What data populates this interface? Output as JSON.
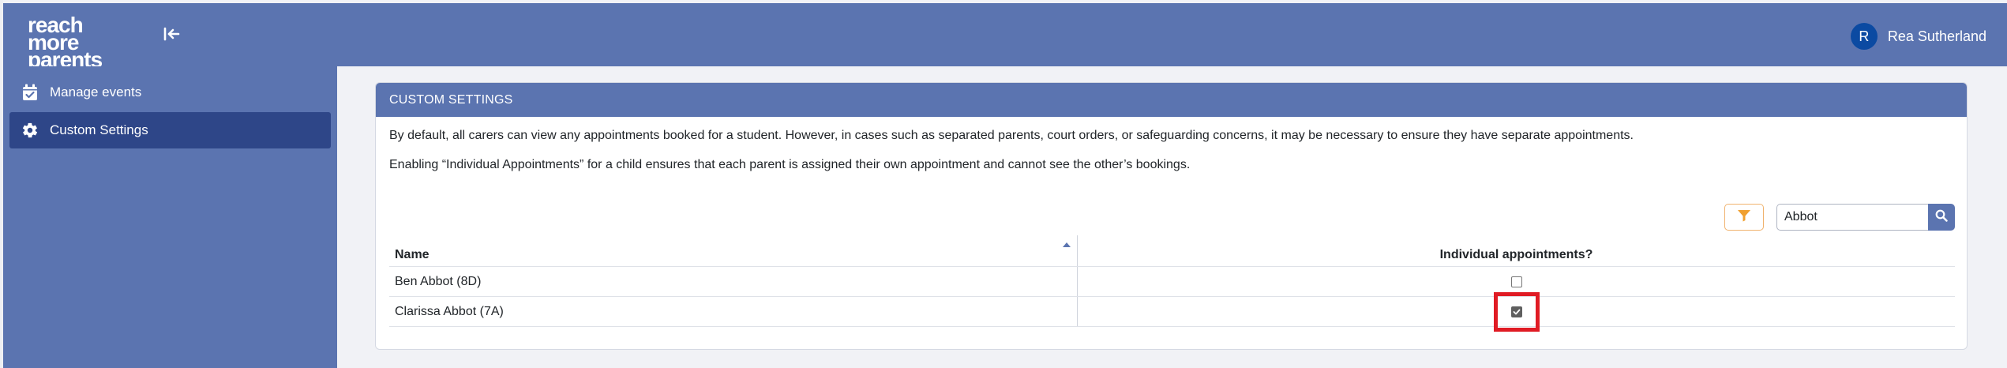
{
  "brand": {
    "line1": "reach more",
    "line2": "parents"
  },
  "user": {
    "initial": "R",
    "name": "Rea Sutherland"
  },
  "sidebar": {
    "items": [
      {
        "label": "Manage events",
        "icon": "calendar-check-icon",
        "active": false
      },
      {
        "label": "Custom Settings",
        "icon": "gear-icon",
        "active": true
      }
    ]
  },
  "card": {
    "title": "CUSTOM SETTINGS",
    "para1": "By default, all carers can view any appointments booked for a student. However, in cases such as separated parents, court orders, or safeguarding concerns, it may be necessary to ensure they have separate appointments.",
    "para2": "Enabling “Individual Appointments” for a child ensures that each parent is assigned their own appointment and cannot see the other’s bookings."
  },
  "search": {
    "value": "Abbot",
    "icon": "search-icon"
  },
  "filter": {
    "icon": "filter-icon",
    "color": "#f0a030"
  },
  "table": {
    "headers": {
      "name": "Name",
      "individual": "Individual appointments?"
    },
    "sort": "name-ascending",
    "rows": [
      {
        "name": "Ben Abbot (8D)",
        "individual": false
      },
      {
        "name": "Clarissa Abbot (7A)",
        "individual": true
      }
    ]
  },
  "colors": {
    "primary": "#5b74b0",
    "sidebar_active": "#2e4688",
    "highlight": "#e01b24"
  }
}
